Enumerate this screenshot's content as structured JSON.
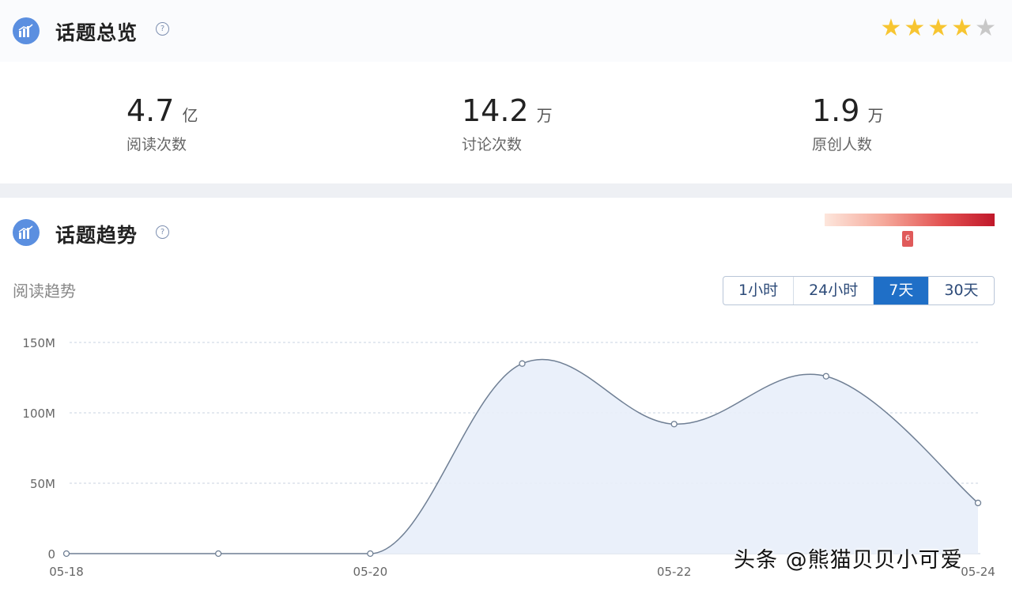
{
  "overview": {
    "title": "话题总览",
    "help_icon": "?",
    "rating": 4,
    "rating_max": 5,
    "stats": [
      {
        "value": "4.7",
        "unit": "亿",
        "label": "阅读次数"
      },
      {
        "value": "14.2",
        "unit": "万",
        "label": "讨论次数"
      },
      {
        "value": "1.9",
        "unit": "万",
        "label": "原创人数"
      }
    ]
  },
  "trend": {
    "title": "话题趋势",
    "help_icon": "?",
    "heat_marker": "6",
    "subtitle": "阅读趋势",
    "ranges": [
      {
        "label": "1小时",
        "active": false
      },
      {
        "label": "24小时",
        "active": false
      },
      {
        "label": "7天",
        "active": true
      },
      {
        "label": "30天",
        "active": false
      }
    ]
  },
  "chart_data": {
    "type": "area",
    "x": [
      "05-18",
      "05-19",
      "05-20",
      "05-21",
      "05-22",
      "05-23",
      "05-24"
    ],
    "x_tick_labels": [
      "05-18",
      "05-20",
      "05-22",
      "05-24"
    ],
    "values": [
      0,
      0,
      0,
      135,
      92,
      126,
      36
    ],
    "y_ticks": [
      "0",
      "50M",
      "100M",
      "150M"
    ],
    "ylim": [
      0,
      150
    ],
    "unit": "M",
    "grid": true,
    "line_color": "#6f7f94",
    "fill_color": "#e8eefa"
  },
  "watermark": "头条 @熊猫贝贝小可爱",
  "colors": {
    "accent": "#1f6fc7",
    "star_on": "#f7c531",
    "star_off": "#c8c8c8",
    "icon_bg": "#5b8fe0"
  }
}
